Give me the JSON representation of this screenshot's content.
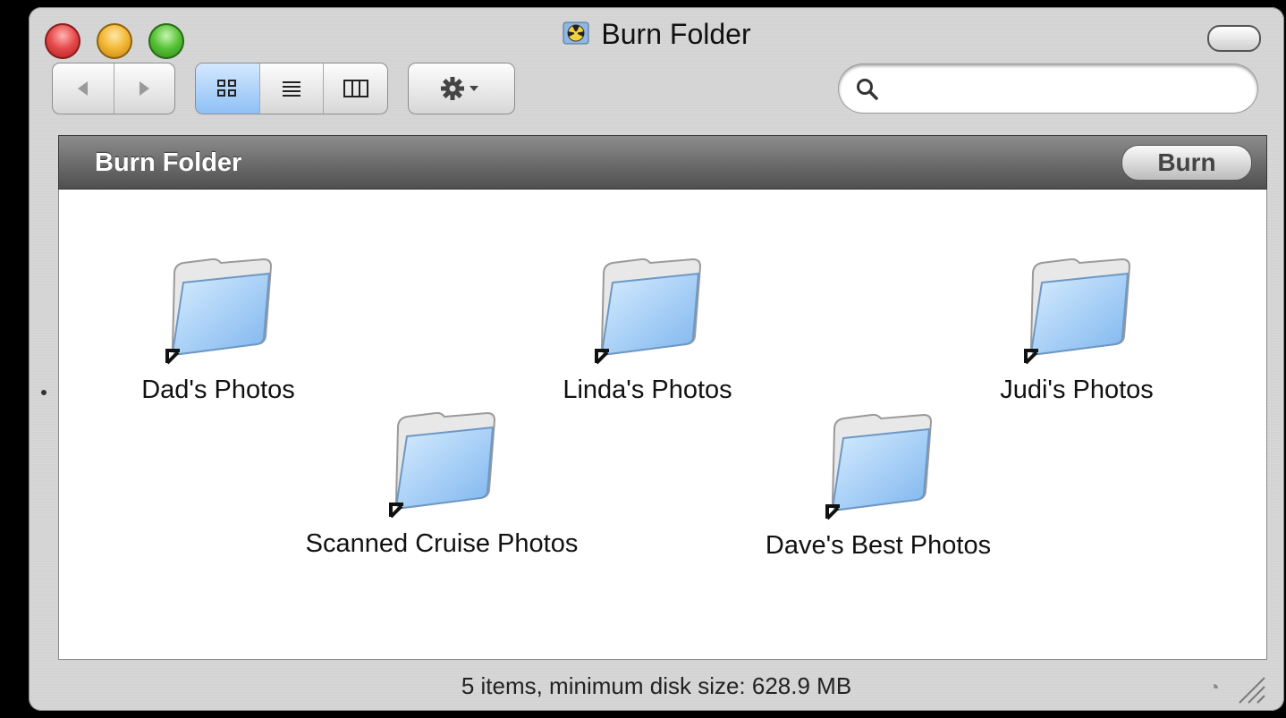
{
  "window": {
    "title": "Burn Folder",
    "title_icon": "burn-folder-icon"
  },
  "toolbar": {
    "back_icon": "back-arrow-icon",
    "forward_icon": "forward-arrow-icon",
    "view_modes": [
      "icon-view",
      "list-view",
      "column-view"
    ],
    "active_view": "icon-view",
    "action_icon": "gear-icon",
    "search": {
      "value": "",
      "placeholder": ""
    }
  },
  "pathbar": {
    "title": "Burn Folder",
    "burn_label": "Burn"
  },
  "items": [
    {
      "name": "Dad's Photos",
      "icon": "folder-alias-icon"
    },
    {
      "name": "Linda's Photos",
      "icon": "folder-alias-icon"
    },
    {
      "name": "Judi's Photos",
      "icon": "folder-alias-icon"
    },
    {
      "name": "Scanned Cruise Photos",
      "icon": "folder-alias-icon"
    },
    {
      "name": "Dave's Best Photos",
      "icon": "folder-alias-icon"
    }
  ],
  "status": {
    "text": "5 items, minimum disk size: 628.9 MB"
  },
  "colors": {
    "pathbar": "#5e5e5e",
    "folder_blue": "#9cc8f4",
    "active_view": "#8ec0f5"
  }
}
